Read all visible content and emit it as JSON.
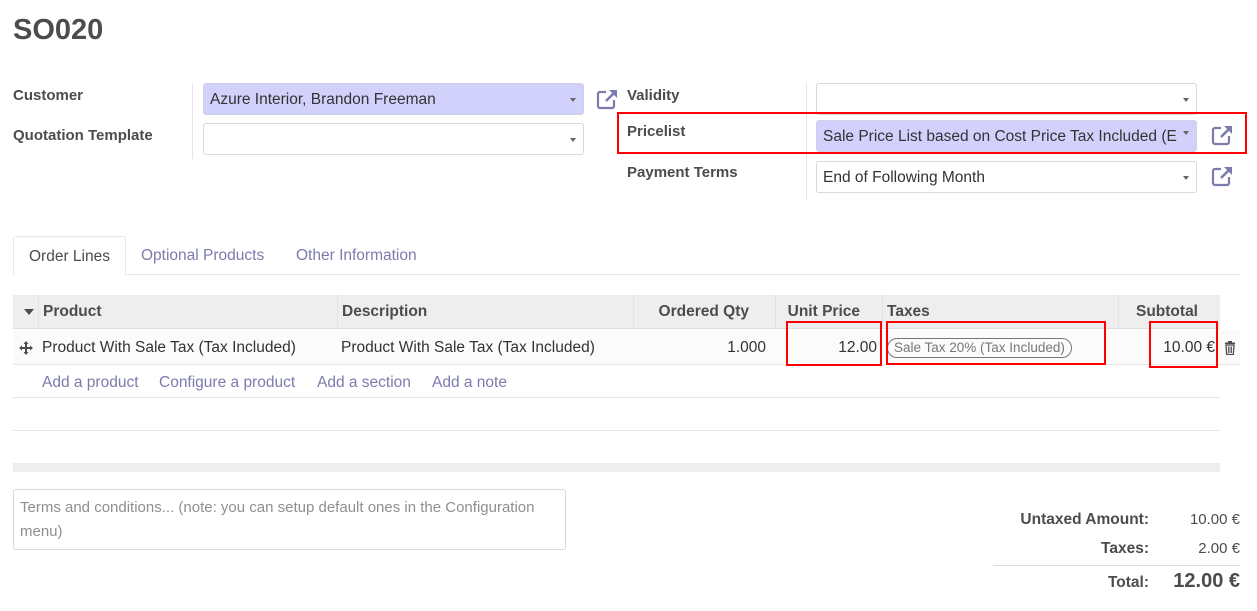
{
  "record": {
    "title": "SO020"
  },
  "form": {
    "left": {
      "customer": {
        "label": "Customer",
        "value": "Azure Interior, Brandon Freeman"
      },
      "quotation_template": {
        "label": "Quotation Template",
        "value": ""
      }
    },
    "right": {
      "validity": {
        "label": "Validity",
        "value": ""
      },
      "pricelist": {
        "label": "Pricelist",
        "value": "Sale Price List based on Cost Price Tax Included (E"
      },
      "payment_terms": {
        "label": "Payment Terms",
        "value": "End of Following Month"
      }
    }
  },
  "tabs": [
    {
      "label": "Order Lines",
      "active": true
    },
    {
      "label": "Optional Products",
      "active": false
    },
    {
      "label": "Other Information",
      "active": false
    }
  ],
  "order_lines": {
    "columns": [
      "Product",
      "Description",
      "Ordered Qty",
      "Unit Price",
      "Taxes",
      "Subtotal"
    ],
    "rows": [
      {
        "product": "Product With Sale Tax (Tax Included)",
        "description": "Product With Sale Tax (Tax Included)",
        "ordered_qty": "1.000",
        "unit_price": "12.00",
        "taxes": [
          "Sale Tax 20% (Tax Included)"
        ],
        "subtotal": "10.00 €"
      }
    ],
    "actions": [
      "Add a product",
      "Configure a product",
      "Add a section",
      "Add a note"
    ]
  },
  "notes": {
    "placeholder": "Terms and conditions... (note: you can setup default ones in the Configuration menu)"
  },
  "totals": {
    "untaxed_label": "Untaxed Amount:",
    "untaxed_value": "10.00 €",
    "taxes_label": "Taxes:",
    "taxes_value": "2.00 €",
    "total_label": "Total:",
    "total_value": "12.00 €"
  },
  "colors": {
    "accent": "#7c7bad",
    "highlight_field": "#d1d1fc",
    "annotation_box": "#ff0000"
  }
}
